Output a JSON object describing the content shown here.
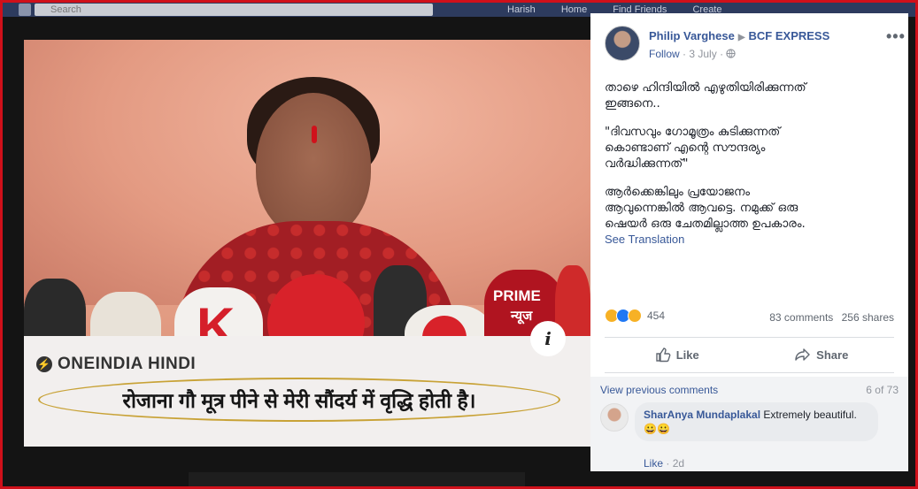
{
  "topbar": {
    "search_placeholder": "Search",
    "nav": [
      "Harish",
      "Home",
      "Find Friends",
      "Create"
    ]
  },
  "photo": {
    "brand": "ONEINDIA HINDI",
    "caption": "रोजाना गौ मूत्र पीने से मेरी सौंदर्य में वृद्धि होती है।",
    "info_glyph": "i",
    "mic_logo_k": "K",
    "mic_logo_prime": "PRIME",
    "mic_logo_news": "न्यूज"
  },
  "post": {
    "author": "Philip Varghese",
    "page": "BCF EXPRESS",
    "follow": "Follow",
    "date": "3 July",
    "text": [
      "താഴെ ഹിന്ദിയിൽ എഴുതിയിരിക്കുന്നത്\nഇങ്ങനെ..",
      "\"ദിവസവും ഗോമൂത്രം കുടിക്കുന്നത്\nകൊണ്ടാണ് എന്റെ സൗന്ദര്യം\nവർദ്ധിക്കുന്നത്\"",
      "ആർക്കെങ്കിലും പ്രയോജനം\nആവുന്നെങ്കിൽ ആവട്ടെ. നമുക്ക് ഒരു\nഷെയർ ഒരു ചേതമില്ലാത്ത ഉപകാരം."
    ],
    "see_translation": "See Translation",
    "reaction_count": "454",
    "comments_count": "83 comments",
    "shares_count": "256 shares",
    "like_label": "Like",
    "share_label": "Share"
  },
  "comments": {
    "view_previous": "View previous comments",
    "position": "6 of 73",
    "items": [
      {
        "name": "SharAnya Mundaplakal",
        "text": "Extremely beautiful.😀😀",
        "like": "Like",
        "time": "2d"
      }
    ]
  },
  "colors": {
    "fb_blue": "#385898",
    "frame_red": "#d0101a",
    "caption_oval": "#c8a236"
  }
}
